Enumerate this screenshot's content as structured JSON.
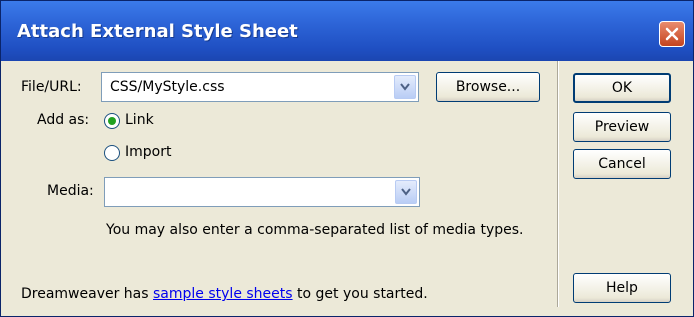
{
  "window": {
    "title": "Attach External Style Sheet"
  },
  "file_url": {
    "label": "File/URL:",
    "value": "CSS/MyStyle.css",
    "browse_label": "Browse..."
  },
  "add_as": {
    "label": "Add as:",
    "options": [
      {
        "label": "Link",
        "selected": true
      },
      {
        "label": "Import",
        "selected": false
      }
    ]
  },
  "media": {
    "label": "Media:",
    "value": "",
    "hint": "You may also enter a comma-separated list of media types."
  },
  "footer": {
    "prefix": "Dreamweaver has",
    "link": "sample style sheets",
    "suffix": "to get you started."
  },
  "buttons": {
    "ok": "OK",
    "preview": "Preview",
    "cancel": "Cancel",
    "help": "Help"
  },
  "colors": {
    "titlebar": "#2c63d6",
    "dialog_bg": "#ece9d8",
    "close": "#c5431e",
    "radio_dot": "#21a121",
    "link": "#0000ee"
  }
}
